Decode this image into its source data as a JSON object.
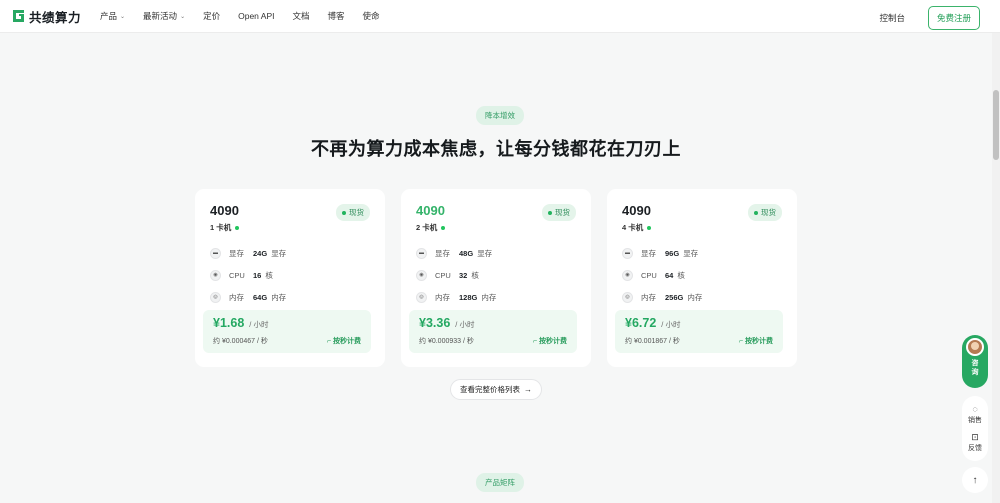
{
  "brand": {
    "name": "共绩算力",
    "color": "#27a862"
  },
  "nav": [
    {
      "label": "产品",
      "dropdown": true
    },
    {
      "label": "最新活动",
      "dropdown": true
    },
    {
      "label": "定价",
      "dropdown": false
    },
    {
      "label": "Open API",
      "dropdown": false
    },
    {
      "label": "文档",
      "dropdown": false
    },
    {
      "label": "博客",
      "dropdown": false
    },
    {
      "label": "使命",
      "dropdown": false
    }
  ],
  "header": {
    "console": "控制台",
    "signup": "免费注册"
  },
  "section": {
    "pill": "降本增效",
    "headline": "不再为算力成本焦虑，让每分钱都花在刀刃上",
    "next_pill": "产品矩阵",
    "more_button": "查看完整价格列表"
  },
  "cards": [
    {
      "title": "4090",
      "highlight": false,
      "badge": "现货",
      "machine": "1 卡机",
      "specs": [
        {
          "icon": "memory-icon",
          "name": "显存",
          "value": "24G",
          "unit": "显存"
        },
        {
          "icon": "cpu-icon",
          "name": "CPU",
          "value": "16",
          "unit": "核"
        },
        {
          "icon": "ram-icon",
          "name": "内存",
          "value": "64G",
          "unit": "内存"
        }
      ],
      "price": "¥1.68",
      "price_unit": "/ 小时",
      "per_second": "约 ¥0.000467 / 秒",
      "billing": "按秒计费"
    },
    {
      "title": "4090",
      "highlight": true,
      "badge": "现货",
      "machine": "2 卡机",
      "specs": [
        {
          "icon": "memory-icon",
          "name": "显存",
          "value": "48G",
          "unit": "显存"
        },
        {
          "icon": "cpu-icon",
          "name": "CPU",
          "value": "32",
          "unit": "核"
        },
        {
          "icon": "ram-icon",
          "name": "内存",
          "value": "128G",
          "unit": "内存"
        }
      ],
      "price": "¥3.36",
      "price_unit": "/ 小时",
      "per_second": "约 ¥0.000933 / 秒",
      "billing": "按秒计费"
    },
    {
      "title": "4090",
      "highlight": false,
      "badge": "现货",
      "machine": "4 卡机",
      "specs": [
        {
          "icon": "memory-icon",
          "name": "显存",
          "value": "96G",
          "unit": "显存"
        },
        {
          "icon": "cpu-icon",
          "name": "CPU",
          "value": "64",
          "unit": "核"
        },
        {
          "icon": "ram-icon",
          "name": "内存",
          "value": "256G",
          "unit": "内存"
        }
      ],
      "price": "¥6.72",
      "price_unit": "/ 小时",
      "per_second": "约 ¥0.001867 / 秒",
      "billing": "按秒计费"
    }
  ],
  "floating": {
    "consult": "咨询",
    "sales": "销售",
    "feedback": "反馈"
  }
}
